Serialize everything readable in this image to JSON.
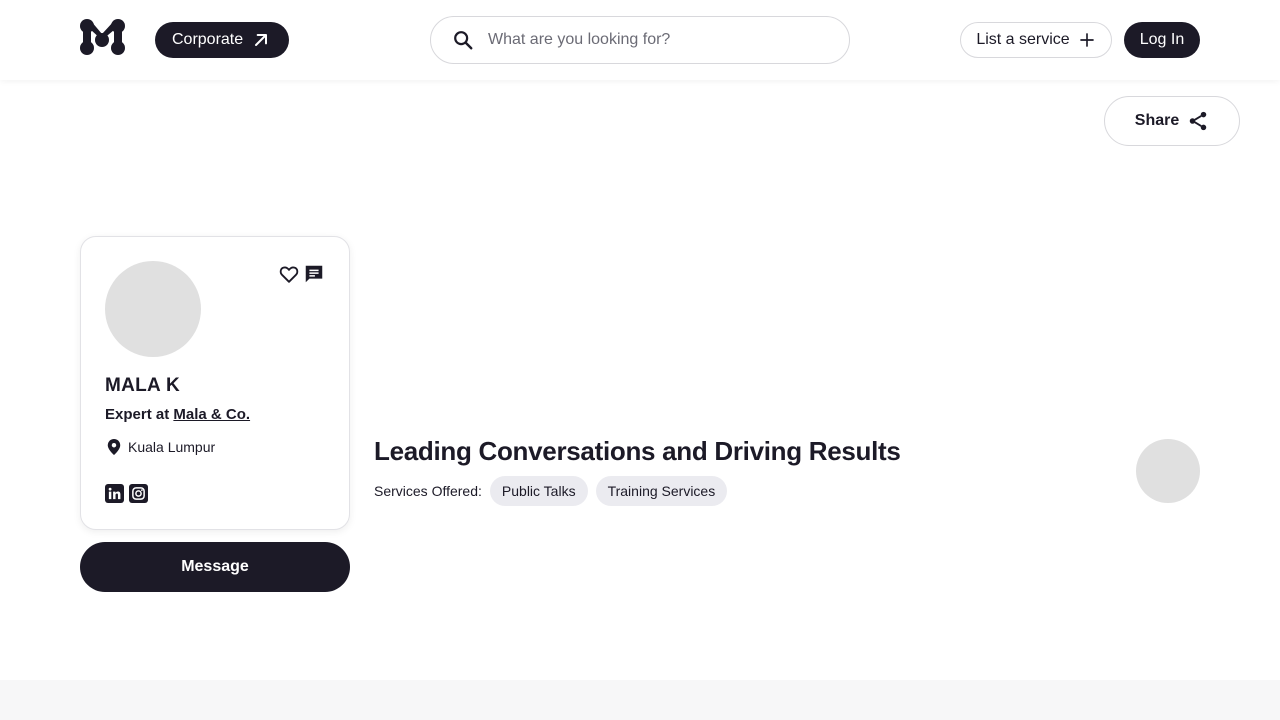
{
  "header": {
    "logo_icon": "brand-m-logo",
    "corporate_label": "Corporate",
    "search_placeholder": "What are you looking for?",
    "list_service_label": "List a service",
    "login_label": "Log In"
  },
  "share": {
    "label": "Share"
  },
  "profile": {
    "name": "MALA K",
    "role_prefix": "Expert at",
    "company": "Mala & Co.",
    "location": "Kuala Lumpur",
    "social": [
      "linkedin-icon",
      "instagram-icon"
    ]
  },
  "actions": {
    "message_label": "Message"
  },
  "main": {
    "headline": "Leading Conversations and Driving Results",
    "services_label": "Services Offered:",
    "services": [
      "Public Talks",
      "Training Services"
    ]
  },
  "colors": {
    "primary": "#1c1a27",
    "avatar_placeholder": "#e0e0e0",
    "tag_bg": "#ebebf0"
  }
}
